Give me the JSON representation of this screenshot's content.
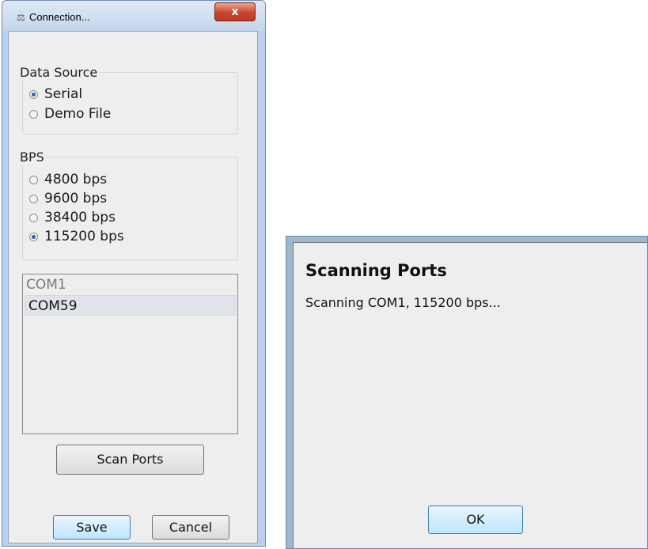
{
  "connection": {
    "title": "Connection...",
    "close_glyph": "x",
    "data_source": {
      "legend": "Data Source",
      "options": [
        {
          "label": "Serial",
          "selected": true
        },
        {
          "label": "Demo File",
          "selected": false
        }
      ]
    },
    "bps": {
      "legend": "BPS",
      "options": [
        {
          "label": "4800 bps",
          "selected": false
        },
        {
          "label": "9600 bps",
          "selected": false
        },
        {
          "label": "38400 bps",
          "selected": false
        },
        {
          "label": "115200 bps",
          "selected": true
        }
      ]
    },
    "ports": [
      "COM1",
      "COM59"
    ],
    "selected_port": "COM59",
    "scan_label": "Scan Ports",
    "save_label": "Save",
    "cancel_label": "Cancel"
  },
  "scanning_dialog": {
    "title": "Scanning Ports",
    "message": "Scanning COM1, 115200 bps...",
    "ok_label": "OK"
  },
  "icons": {
    "app_icon": "connection-icon",
    "close_icon": "close-icon"
  },
  "colors": {
    "radio_selected": "#2f5fb0",
    "close_button": "#c9452f",
    "default_button_border": "#3c7fb1"
  }
}
